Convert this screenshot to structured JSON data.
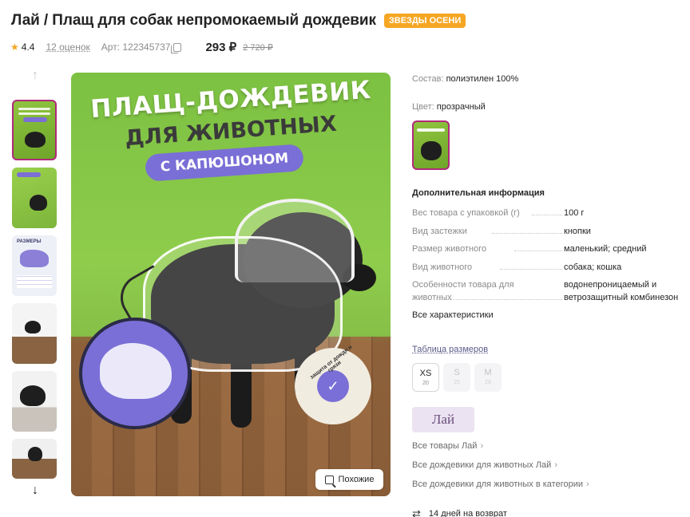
{
  "header": {
    "title": "Лай / Плащ для собак непромокаемый дождевик",
    "badge": "ЗВЕЗДЫ ОСЕНИ",
    "rating": "4.4",
    "reviews": "12 оценок",
    "article": "Арт: 122345737",
    "price": "293 ₽",
    "old_price": "2 720 ₽",
    "star_icon": "star-icon",
    "copy_icon": "copy-icon"
  },
  "gallery": {
    "thumb_count": 6,
    "up_arrow": "↑",
    "down_arrow": "↓",
    "thumb3_label": "РАЗМЕРЫ"
  },
  "main_image": {
    "headline1": "ПЛАЩ-ДОЖДЕВИК",
    "headline2": "ДЛЯ ЖИВОТНЫХ",
    "pill": "С КАПЮШОНОМ",
    "badge_text": "защита от дождя и грязи",
    "similar_button": "Похожие"
  },
  "details": {
    "composition_label": "Состав:",
    "composition_value": "полиэтилен 100%",
    "color_label": "Цвет:",
    "color_value": "прозрачный",
    "additional_title": "Дополнительная информация",
    "specs": [
      {
        "name": "Вес товара с упаковкой (г)",
        "value": "100 г"
      },
      {
        "name": "Вид застежки",
        "value": "кнопки"
      },
      {
        "name": "Размер животного",
        "value": "маленький; средний"
      },
      {
        "name": "Вид животного",
        "value": "собака; кошка"
      },
      {
        "name": "Особенности товара для животных",
        "value": "водонепроницаемый и ветрозащитный комбинезон"
      }
    ],
    "all_characteristics": "Все характеристики",
    "size_table": "Таблица размеров",
    "sizes": [
      {
        "name": "XS",
        "num": "20"
      },
      {
        "name": "S",
        "num": "25"
      },
      {
        "name": "M",
        "num": "28"
      }
    ],
    "brand": "Лай",
    "links": [
      "Все товары Лай",
      "Все дождевики для животных Лай",
      "Все дождевики для животных в категории"
    ],
    "returns": "14 дней на возврат"
  },
  "colors": {
    "badge": "#f5a623",
    "accent": "#b02a7a",
    "purple": "#7a6fd6",
    "image_green": "#7cc142"
  }
}
